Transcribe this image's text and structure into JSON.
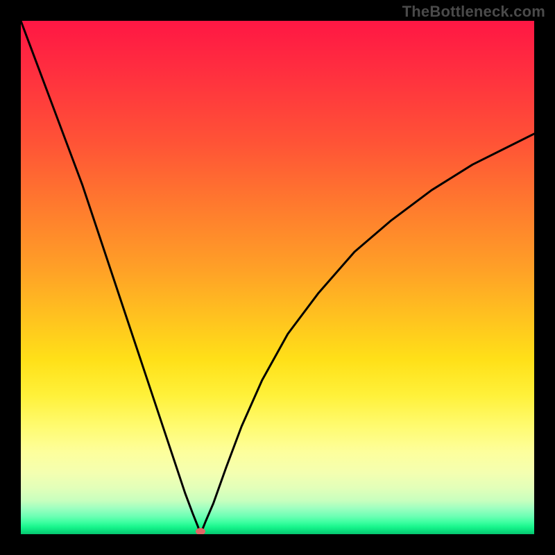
{
  "watermark": "TheBottleneck.com",
  "colors": {
    "curve_stroke": "#000000",
    "marker_fill": "#e06666",
    "frame_bg": "#000000"
  },
  "chart_data": {
    "type": "line",
    "title": "",
    "xlabel": "",
    "ylabel": "",
    "xlim": [
      0,
      100
    ],
    "ylim": [
      0,
      100
    ],
    "grid": false,
    "legend": false,
    "annotations": [
      "TheBottleneck.com"
    ],
    "marker": {
      "x": 35,
      "y": 0.5
    },
    "series": [
      {
        "name": "left-branch",
        "x": [
          0,
          3,
          6,
          9,
          12,
          15,
          18,
          21,
          24,
          27,
          30,
          32,
          33.5,
          34.5,
          35
        ],
        "values": [
          100,
          92,
          84,
          76,
          68,
          59,
          50,
          41,
          32,
          23,
          14,
          8,
          4,
          1.5,
          0
        ]
      },
      {
        "name": "right-branch",
        "x": [
          35,
          36,
          37.5,
          40,
          43,
          47,
          52,
          58,
          65,
          72,
          80,
          88,
          94,
          100
        ],
        "values": [
          0,
          2.5,
          6,
          13,
          21,
          30,
          39,
          47,
          55,
          61,
          67,
          72,
          75,
          78
        ]
      }
    ]
  }
}
